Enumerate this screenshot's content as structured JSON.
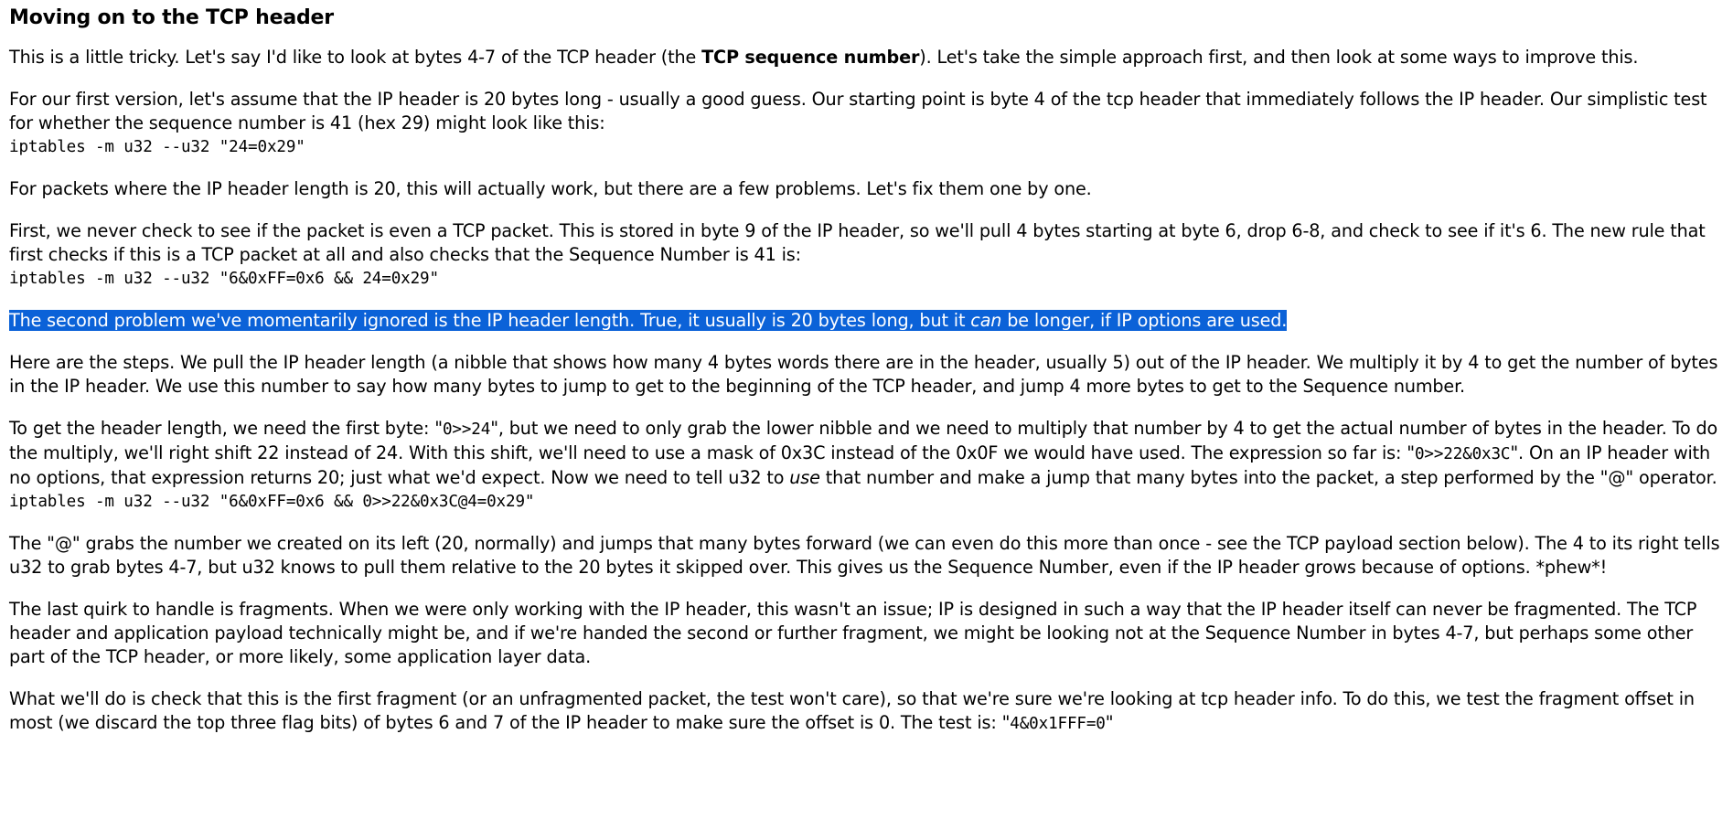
{
  "heading": "Moving on to the TCP header",
  "para1": {
    "before": "This is a little tricky. Let's say I'd like to look at bytes 4-7 of the TCP header (the ",
    "bold": "TCP sequence number",
    "after": "). Let's take the simple approach first, and then look at some ways to improve this."
  },
  "para2": "For our first version, let's assume that the IP header is 20 bytes long - usually a good guess. Our starting point is byte 4 of the tcp header that immediately follows the IP header. Our simplistic test for whether the sequence number is 41 (hex 29) might look like this:",
  "code1": "iptables -m u32 --u32 \"24=0x29\"",
  "para3": "For packets where the IP header length is 20, this will actually work, but there are a few problems. Let's fix them one by one.",
  "para4": "First, we never check to see if the packet is even a TCP packet. This is stored in byte 9 of the IP header, so we'll pull 4 bytes starting at byte 6, drop 6-8, and check to see if it's 6. The new rule that first checks if this is a TCP packet at all and also checks that the Sequence Number is 41 is:",
  "code2": "iptables -m u32 --u32 \"6&0xFF=0x6 && 24=0x29\"",
  "para5": {
    "before": "The second problem we've momentarily ignored is the IP header length. True, it usually is 20 bytes long, but it ",
    "italic": "can",
    "after": " be longer, if IP options are used."
  },
  "para6": "Here are the steps. We pull the IP header length (a nibble that shows how many 4 bytes words there are in the header, usually 5) out of the IP header. We multiply it by 4 to get the number of bytes in the IP header. We use this number to say how many bytes to jump to get to the beginning of the TCP header, and jump 4 more bytes to get to the Sequence number.",
  "para7": {
    "t1": "To get the header length, we need the first byte: \"",
    "c1": "0>>24",
    "t2": "\", but we need to only grab the lower nibble and we need to multiply that number by 4 to get the actual number of bytes in the header. To do the multiply, we'll right shift 22 instead of 24. With this shift, we'll need to use a mask of 0x3C instead of the 0x0F we would have used. The expression so far is: \"",
    "c2": "0>>22&0x3C",
    "t3": "\". On an IP header with no options, that expression returns 20; just what we'd expect. Now we need to tell u32 to ",
    "italic": "use",
    "t4": " that number and make a jump that many bytes into the packet, a step performed by the \"@\" operator."
  },
  "code3": "iptables -m u32 --u32 \"6&0xFF=0x6 && 0>>22&0x3C@4=0x29\"",
  "para8": "The \"@\" grabs the number we created on its left (20, normally) and jumps that many bytes forward (we can even do this more than once - see the TCP payload section below). The 4 to its right tells u32 to grab bytes 4-7, but u32 knows to pull them relative to the 20 bytes it skipped over. This gives us the Sequence Number, even if the IP header grows because of options. *phew*!",
  "para9": "The last quirk to handle is fragments. When we were only working with the IP header, this wasn't an issue; IP is designed in such a way that the IP header itself can never be fragmented. The TCP header and application payload technically might be, and if we're handed the second or further fragment, we might be looking not at the Sequence Number in bytes 4-7, but perhaps some other part of the TCP header, or more likely, some application layer data.",
  "para10": {
    "text": "What we'll do is check that this is the first fragment (or an unfragmented packet, the test won't care), so that we're sure we're looking at tcp header info. To do this, we test the fragment offset in most (we discard the top three flag bits) of bytes 6 and 7 of the IP header to make sure the offset is 0. The test is: \"",
    "code": "4&0x1FFF=0",
    "end": "\""
  },
  "colors": {
    "selection_bg": "#0b62d8",
    "selection_text": "#ffffff",
    "text": "#000000",
    "background": "#ffffff"
  }
}
